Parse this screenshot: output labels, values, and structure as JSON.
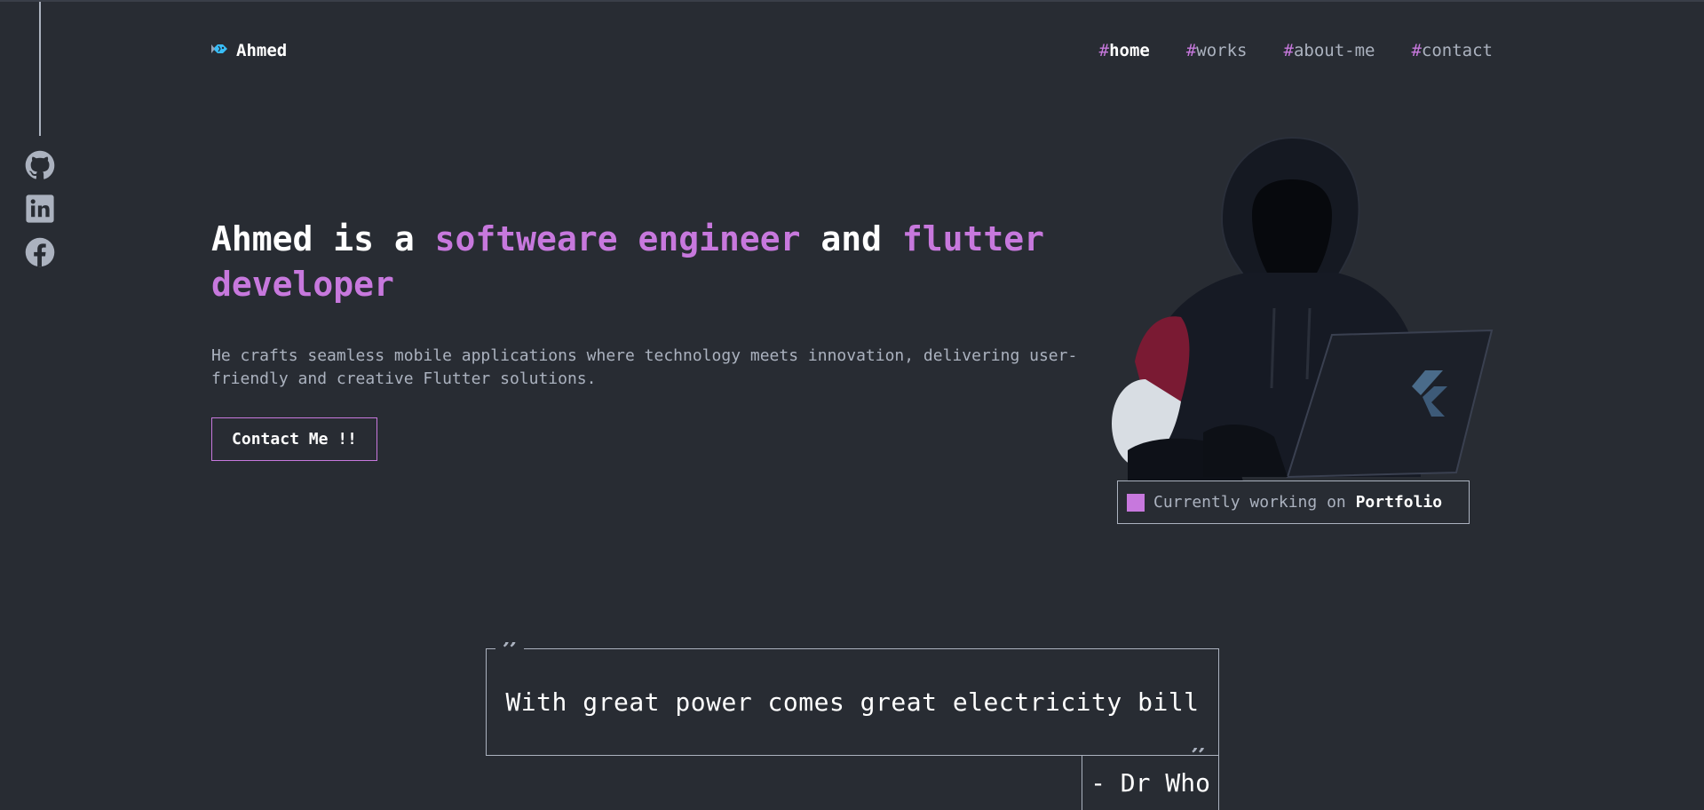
{
  "brand": {
    "name": "Ahmed",
    "logo_icon": "fish-logo-icon"
  },
  "nav": {
    "items": [
      {
        "hash": "#",
        "label": "home",
        "active": true
      },
      {
        "hash": "#",
        "label": "works",
        "active": false
      },
      {
        "hash": "#",
        "label": "about-me",
        "active": false
      },
      {
        "hash": "#",
        "label": "contact",
        "active": false
      }
    ]
  },
  "social": [
    {
      "name": "github",
      "icon": "github-icon"
    },
    {
      "name": "linkedin",
      "icon": "linkedin-icon"
    },
    {
      "name": "facebook",
      "icon": "facebook-icon"
    }
  ],
  "hero": {
    "title_part1": "Ahmed is a ",
    "title_accent1": "softweare engineer",
    "title_part2": " and ",
    "title_accent2": "flutter developer",
    "description": "He crafts seamless mobile applications where technology meets innovation, delivering user-friendly and creative Flutter solutions.",
    "cta_label": "Contact Me !!",
    "illustration": "hooded-developer-with-laptop-illustration"
  },
  "status": {
    "prefix": "Currently working on ",
    "project": "Portfolio"
  },
  "quote": {
    "mark": "”",
    "text": "With great power comes great electricity bill",
    "author": "- Dr Who"
  },
  "colors": {
    "background": "#282c33",
    "accent": "#c778dd",
    "text": "#abb2bf",
    "heading": "#ffffff"
  }
}
